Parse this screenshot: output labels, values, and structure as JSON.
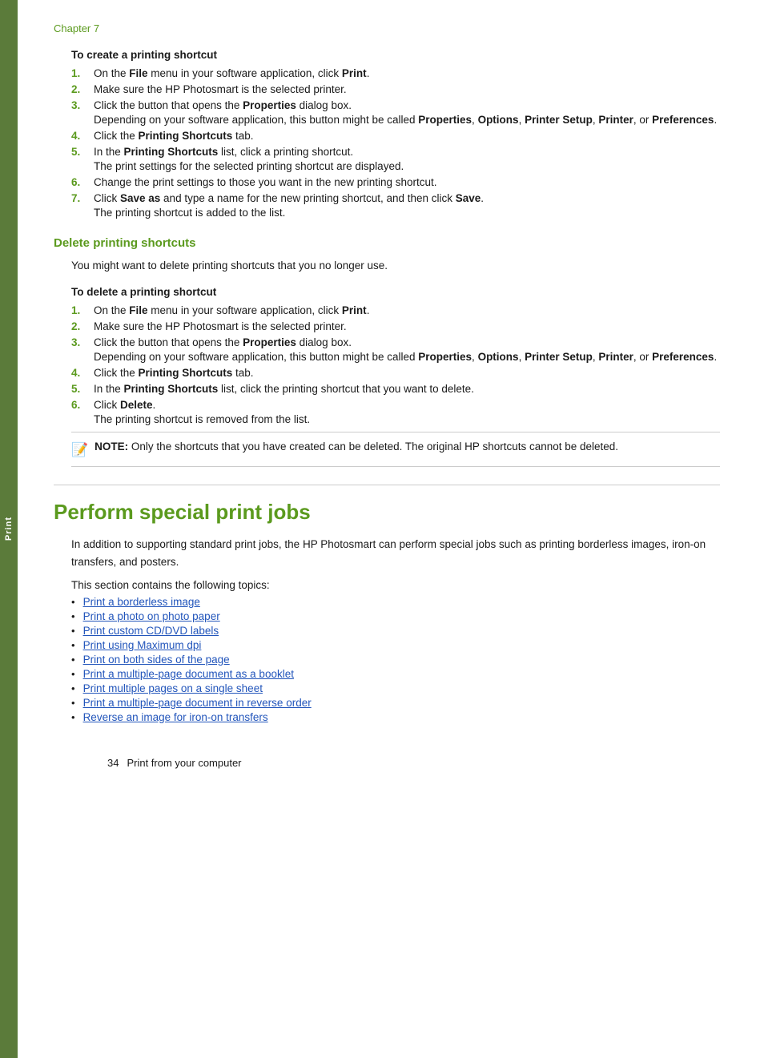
{
  "left_tab": {
    "label": "Print"
  },
  "chapter_label": "Chapter 7",
  "create_shortcut": {
    "heading": "To create a printing shortcut",
    "steps": [
      {
        "num": "1.",
        "text_plain": "On the ",
        "text_bold1": "File",
        "text_mid": " menu in your software application, click ",
        "text_bold2": "Print",
        "text_end": "."
      },
      {
        "num": "2.",
        "text": "Make sure the HP Photosmart is the selected printer."
      },
      {
        "num": "3.",
        "text_plain": "Click the button that opens the ",
        "text_bold1": "Properties",
        "text_end": " dialog box.",
        "sub": "Depending on your software application, this button might be called ",
        "sub_bold1": "Properties",
        "sub_sep1": ", ",
        "sub_bold2": "Options",
        "sub_sep2": ", ",
        "sub_bold3": "Printer Setup",
        "sub_sep3": ", ",
        "sub_bold4": "Printer",
        "sub_sep4": ", or ",
        "sub_bold5": "Preferences",
        "sub_end": "."
      },
      {
        "num": "4.",
        "text_plain": "Click the ",
        "text_bold1": "Printing Shortcuts",
        "text_end": " tab."
      },
      {
        "num": "5.",
        "text_plain": "In the ",
        "text_bold1": "Printing Shortcuts",
        "text_mid": " list, click a printing shortcut.",
        "sub": "The print settings for the selected printing shortcut are displayed."
      },
      {
        "num": "6.",
        "text": "Change the print settings to those you want in the new printing shortcut."
      },
      {
        "num": "7.",
        "text_plain": "Click ",
        "text_bold1": "Save as",
        "text_mid": " and type a name for the new printing shortcut, and then click ",
        "text_bold2": "Save",
        "text_end": ".",
        "sub": "The printing shortcut is added to the list."
      }
    ]
  },
  "delete_shortcuts": {
    "section_title": "Delete printing shortcuts",
    "intro": "You might want to delete printing shortcuts that you no longer use.",
    "heading": "To delete a printing shortcut",
    "steps": [
      {
        "num": "1.",
        "text_plain": "On the ",
        "text_bold1": "File",
        "text_mid": " menu in your software application, click ",
        "text_bold2": "Print",
        "text_end": "."
      },
      {
        "num": "2.",
        "text": "Make sure the HP Photosmart is the selected printer."
      },
      {
        "num": "3.",
        "text_plain": "Click the button that opens the ",
        "text_bold1": "Properties",
        "text_end": " dialog box.",
        "sub": "Depending on your software application, this button might be called ",
        "sub_bold1": "Properties",
        "sub_sep1": ", ",
        "sub_bold2": "Options",
        "sub_sep2": ", ",
        "sub_bold3": "Printer Setup",
        "sub_sep3": ", ",
        "sub_bold4": "Printer",
        "sub_sep4": ", or ",
        "sub_bold5": "Preferences",
        "sub_end": "."
      },
      {
        "num": "4.",
        "text_plain": "Click the ",
        "text_bold1": "Printing Shortcuts",
        "text_end": " tab."
      },
      {
        "num": "5.",
        "text_plain": "In the ",
        "text_bold1": "Printing Shortcuts",
        "text_mid": " list, click the printing shortcut that you want to delete."
      },
      {
        "num": "6.",
        "text_plain": "Click ",
        "text_bold1": "Delete",
        "text_end": ".",
        "sub": "The printing shortcut is removed from the list."
      }
    ],
    "note_label": "NOTE:",
    "note_text": "  Only the shortcuts that you have created can be deleted. The original HP shortcuts cannot be deleted."
  },
  "perform_section": {
    "title": "Perform special print jobs",
    "intro1": "In addition to supporting standard print jobs, the HP Photosmart can perform special jobs such as printing borderless images, iron-on transfers, and posters.",
    "intro2": "This section contains the following topics:",
    "links": [
      "Print a borderless image",
      "Print a photo on photo paper",
      "Print custom CD/DVD labels",
      "Print using Maximum dpi",
      "Print on both sides of the page",
      "Print a multiple-page document as a booklet",
      "Print multiple pages on a single sheet",
      "Print a multiple-page document in reverse order",
      "Reverse an image for iron-on transfers"
    ]
  },
  "footer": {
    "page_num": "34",
    "text": "Print from your computer"
  }
}
